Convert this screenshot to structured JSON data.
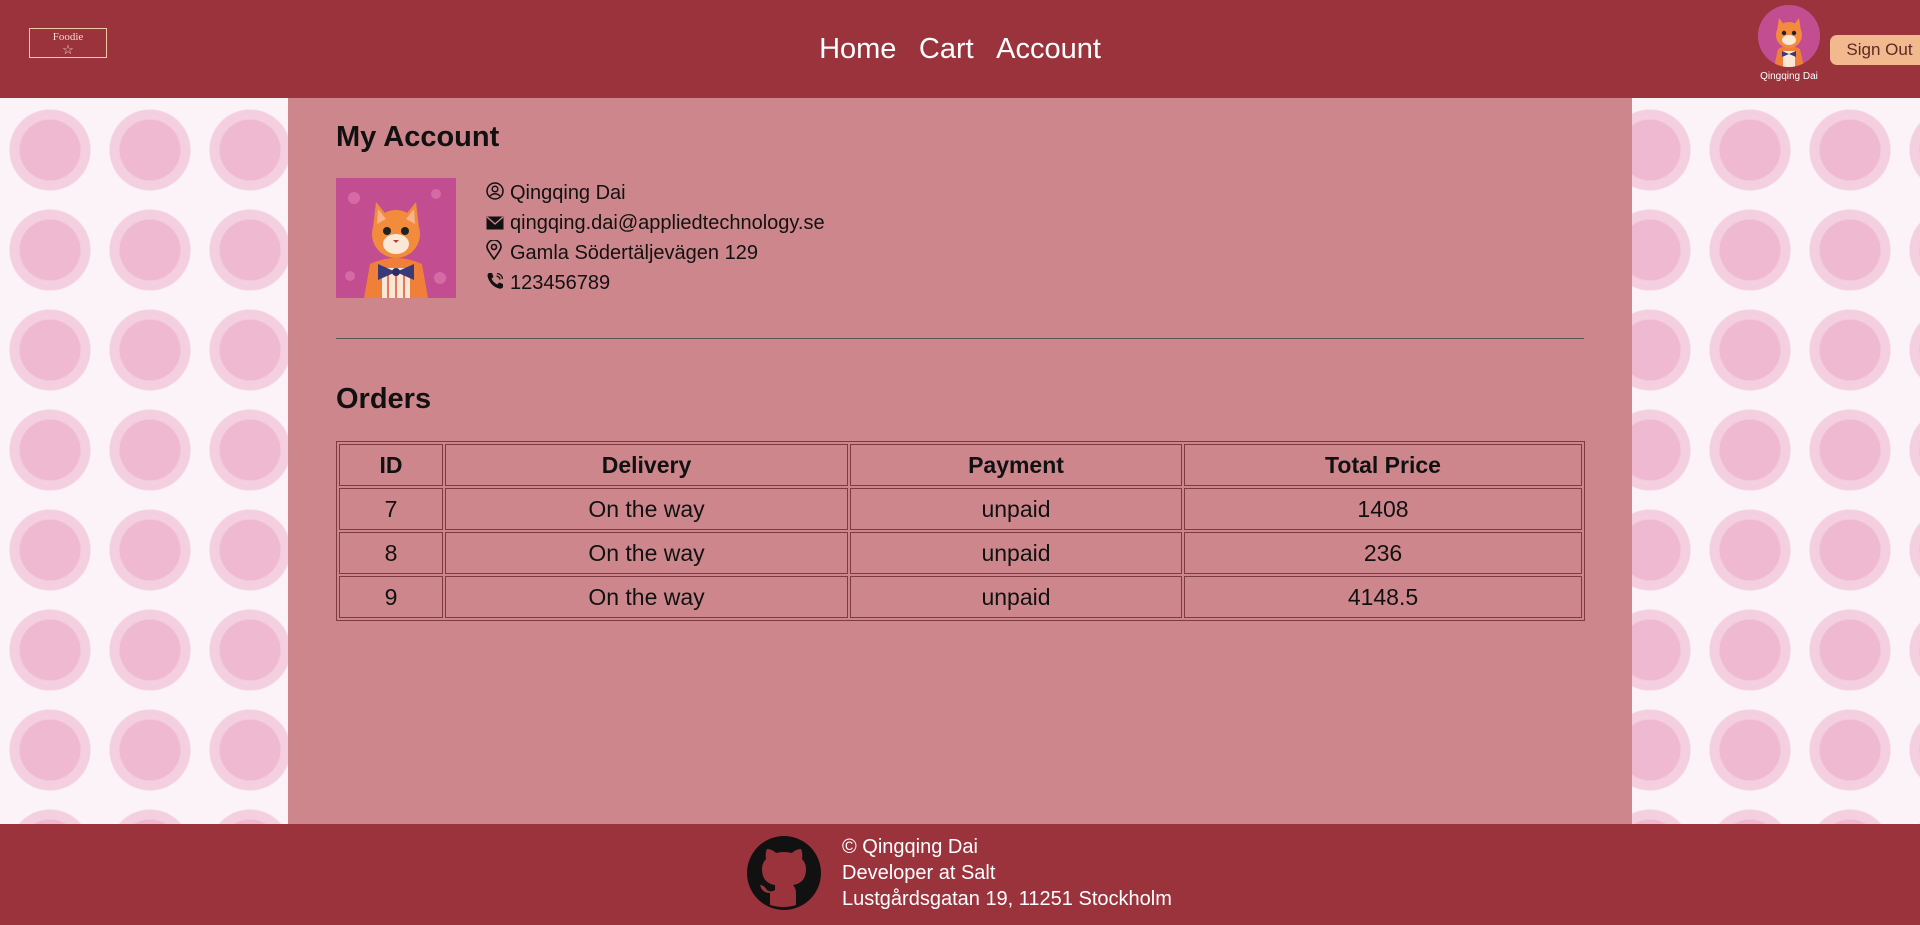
{
  "header": {
    "logo_text": "Foodie",
    "logo_icon": "star-icon",
    "nav": [
      "Home",
      "Cart",
      "Account"
    ],
    "user_name": "Qingqing Dai",
    "signout_label": "Sign Out"
  },
  "account": {
    "title": "My Account",
    "name": "Qingqing Dai",
    "email": "qingqing.dai@appliedtechnology.se",
    "address": "Gamla Södertäljevägen 129",
    "phone": "123456789"
  },
  "orders": {
    "title": "Orders",
    "columns": [
      "ID",
      "Delivery",
      "Payment",
      "Total Price"
    ],
    "rows": [
      [
        "7",
        "On the way",
        "unpaid",
        "1408"
      ],
      [
        "8",
        "On the way",
        "unpaid",
        "236"
      ],
      [
        "9",
        "On the way",
        "unpaid",
        "4148.5"
      ]
    ]
  },
  "footer": {
    "copyright": "© Qingqing Dai",
    "role": "Developer at Salt",
    "address": "Lustgårdsgatan 19, 11251 Stockholm"
  },
  "colors": {
    "header_bg": "#9b333d",
    "main_bg": "#cd878c",
    "signout_bg": "#f2b98f"
  }
}
